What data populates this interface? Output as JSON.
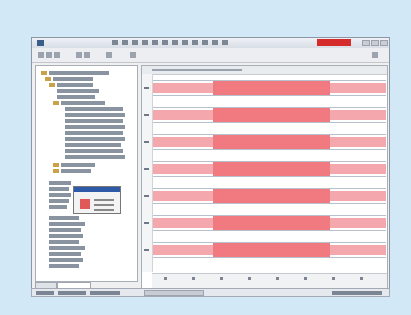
{
  "window": {
    "title": "",
    "brand_label": ""
  },
  "popup": {
    "title": ""
  },
  "chart_data": {
    "type": "table",
    "rows": [
      {
        "segments": [
          "light",
          "strong",
          "light"
        ]
      },
      {
        "segments": [
          "light",
          "strong",
          "light"
        ]
      },
      {
        "segments": [
          "light",
          "strong",
          "light"
        ]
      },
      {
        "segments": [
          "light",
          "strong",
          "light"
        ]
      },
      {
        "segments": [
          "light",
          "strong",
          "light"
        ]
      },
      {
        "segments": [
          "light",
          "strong",
          "light"
        ]
      },
      {
        "segments": [
          "light",
          "strong",
          "light"
        ]
      }
    ],
    "colors": {
      "light": "#f4a8ad",
      "strong": "#f07a80",
      "grid": "#b8c0cb"
    }
  },
  "icons": {
    "app": "app-icon",
    "close": "close-icon",
    "maximize": "maximize-icon",
    "minimize": "minimize-icon"
  },
  "colors": {
    "background": "#d3e8f6",
    "brand": "#d52b2b",
    "selection": "#2e5aa8"
  }
}
